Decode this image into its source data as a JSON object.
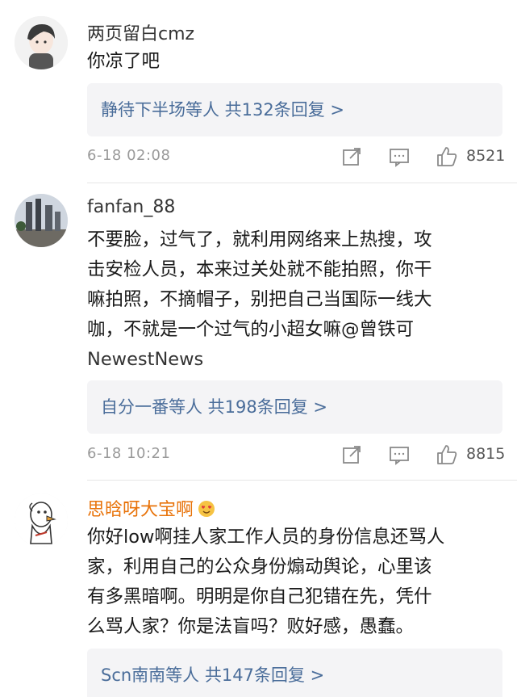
{
  "comments": [
    {
      "username": "两页留白cmz",
      "text_lines": [
        "你凉了吧"
      ],
      "reply_summary": "静待下半场等人 共132条回复 >",
      "timestamp": "6-18 02:08",
      "likes": "8521",
      "avatar": "cartoon-boy-avatar"
    },
    {
      "username": "fanfan_88",
      "text_lines": [
        "不要脸，过气了，就利用网络来上热搜，攻",
        "击安检人员，本来过关处就不能拍照，你干",
        "嘛拍照，不摘帽子，别把自己当国际一线大",
        "咖，不就是一个过气的小超女嘛@曾铁可"
      ],
      "mention_line": "NewestNews",
      "reply_summary": "自分一番等人 共198条回复 >",
      "timestamp": "6-18 10:21",
      "likes": "8815",
      "avatar": "city-skyline-avatar"
    },
    {
      "username": "思晗呀大宝啊",
      "username_color": "#e8730a",
      "text_lines": [
        "你好low啊挂人家工作人员的身份信息还骂人",
        "家，利用自己的公众身份煽动舆论，心里该",
        "有多黑暗啊。明明是你自己犯错在先，凭什",
        "么骂人家？你是法盲吗？败好感，愚蠢。"
      ],
      "reply_summary": "Scn南南等人 共147条回复 >",
      "avatar": "goose-cartoon-avatar"
    }
  ],
  "icons": {
    "share": "share-icon",
    "comment": "comment-icon",
    "like": "thumbs-up-icon",
    "badge": "heart-eyes-emoji-icon"
  },
  "colors": {
    "reply_link": "#4a6d9a",
    "highlight_username": "#e8730a",
    "meta_gray": "#9a9a9a"
  }
}
